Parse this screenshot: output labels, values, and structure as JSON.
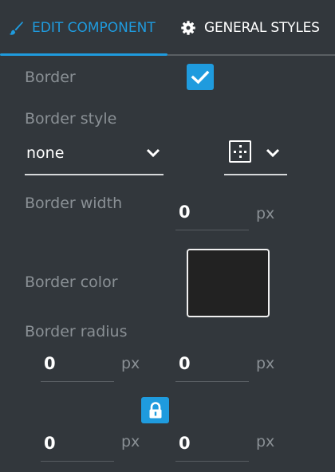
{
  "tabs": [
    {
      "label": "EDIT COMPONENT",
      "icon": "brush-icon",
      "active": true
    },
    {
      "label": "GENERAL STYLES",
      "icon": "gear-icon",
      "active": false
    }
  ],
  "colors": {
    "accent": "#1f9bde",
    "background": "#32373c",
    "label": "#8a9095",
    "swatch": "#222222"
  },
  "form": {
    "border": {
      "label": "Border",
      "checked": true
    },
    "border_style": {
      "label": "Border style",
      "value": "none",
      "style_icon": "border-style-dotted-icon"
    },
    "border_width": {
      "label": "Border width",
      "value": "0",
      "unit": "px"
    },
    "border_color": {
      "label": "Border color",
      "value": "#222222"
    },
    "border_radius": {
      "label": "Border radius",
      "top_left": {
        "value": "0",
        "unit": "px"
      },
      "top_right": {
        "value": "0",
        "unit": "px"
      },
      "bottom_left": {
        "value": "0",
        "unit": "px"
      },
      "bottom_right": {
        "value": "0",
        "unit": "px"
      },
      "locked": true
    }
  }
}
